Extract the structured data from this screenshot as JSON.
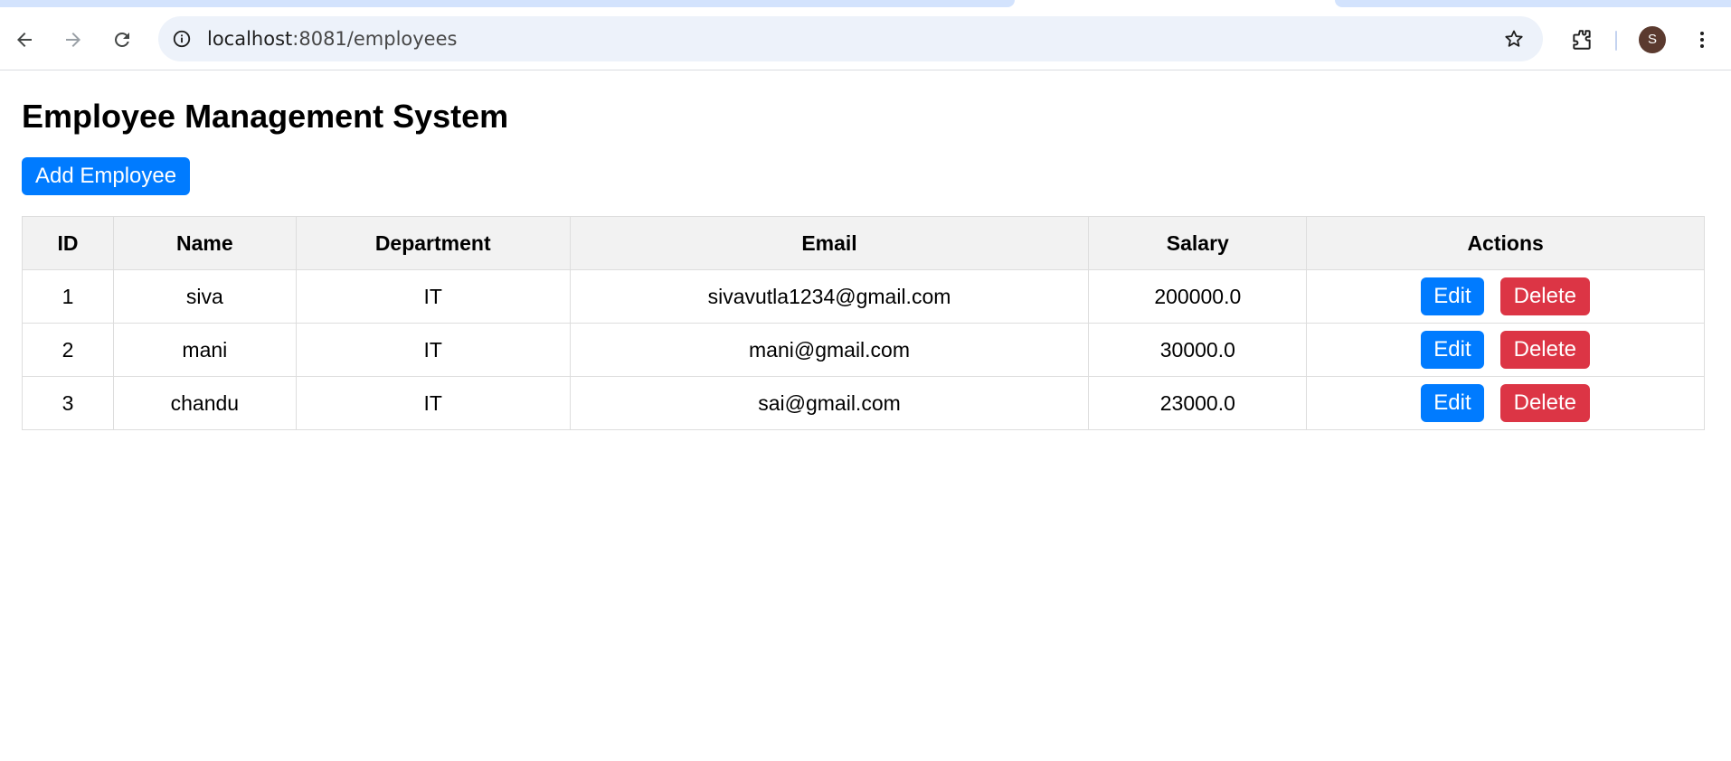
{
  "browser": {
    "url_host": "localhost",
    "url_path": ":8081/employees",
    "profile_initial": "S"
  },
  "page": {
    "title": "Employee Management System",
    "add_button_label": "Add Employee"
  },
  "table": {
    "headers": {
      "id": "ID",
      "name": "Name",
      "department": "Department",
      "email": "Email",
      "salary": "Salary",
      "actions": "Actions"
    },
    "rows": [
      {
        "id": "1",
        "name": "siva",
        "department": "IT",
        "email": "sivavutla1234@gmail.com",
        "salary": "200000.0"
      },
      {
        "id": "2",
        "name": "mani",
        "department": "IT",
        "email": "mani@gmail.com",
        "salary": "30000.0"
      },
      {
        "id": "3",
        "name": "chandu",
        "department": "IT",
        "email": "sai@gmail.com",
        "salary": "23000.0"
      }
    ],
    "edit_label": "Edit",
    "delete_label": "Delete"
  },
  "colors": {
    "primary": "#007bff",
    "danger": "#dc3545",
    "header_bg": "#f2f2f2",
    "omnibox_bg": "#edf2fa"
  }
}
